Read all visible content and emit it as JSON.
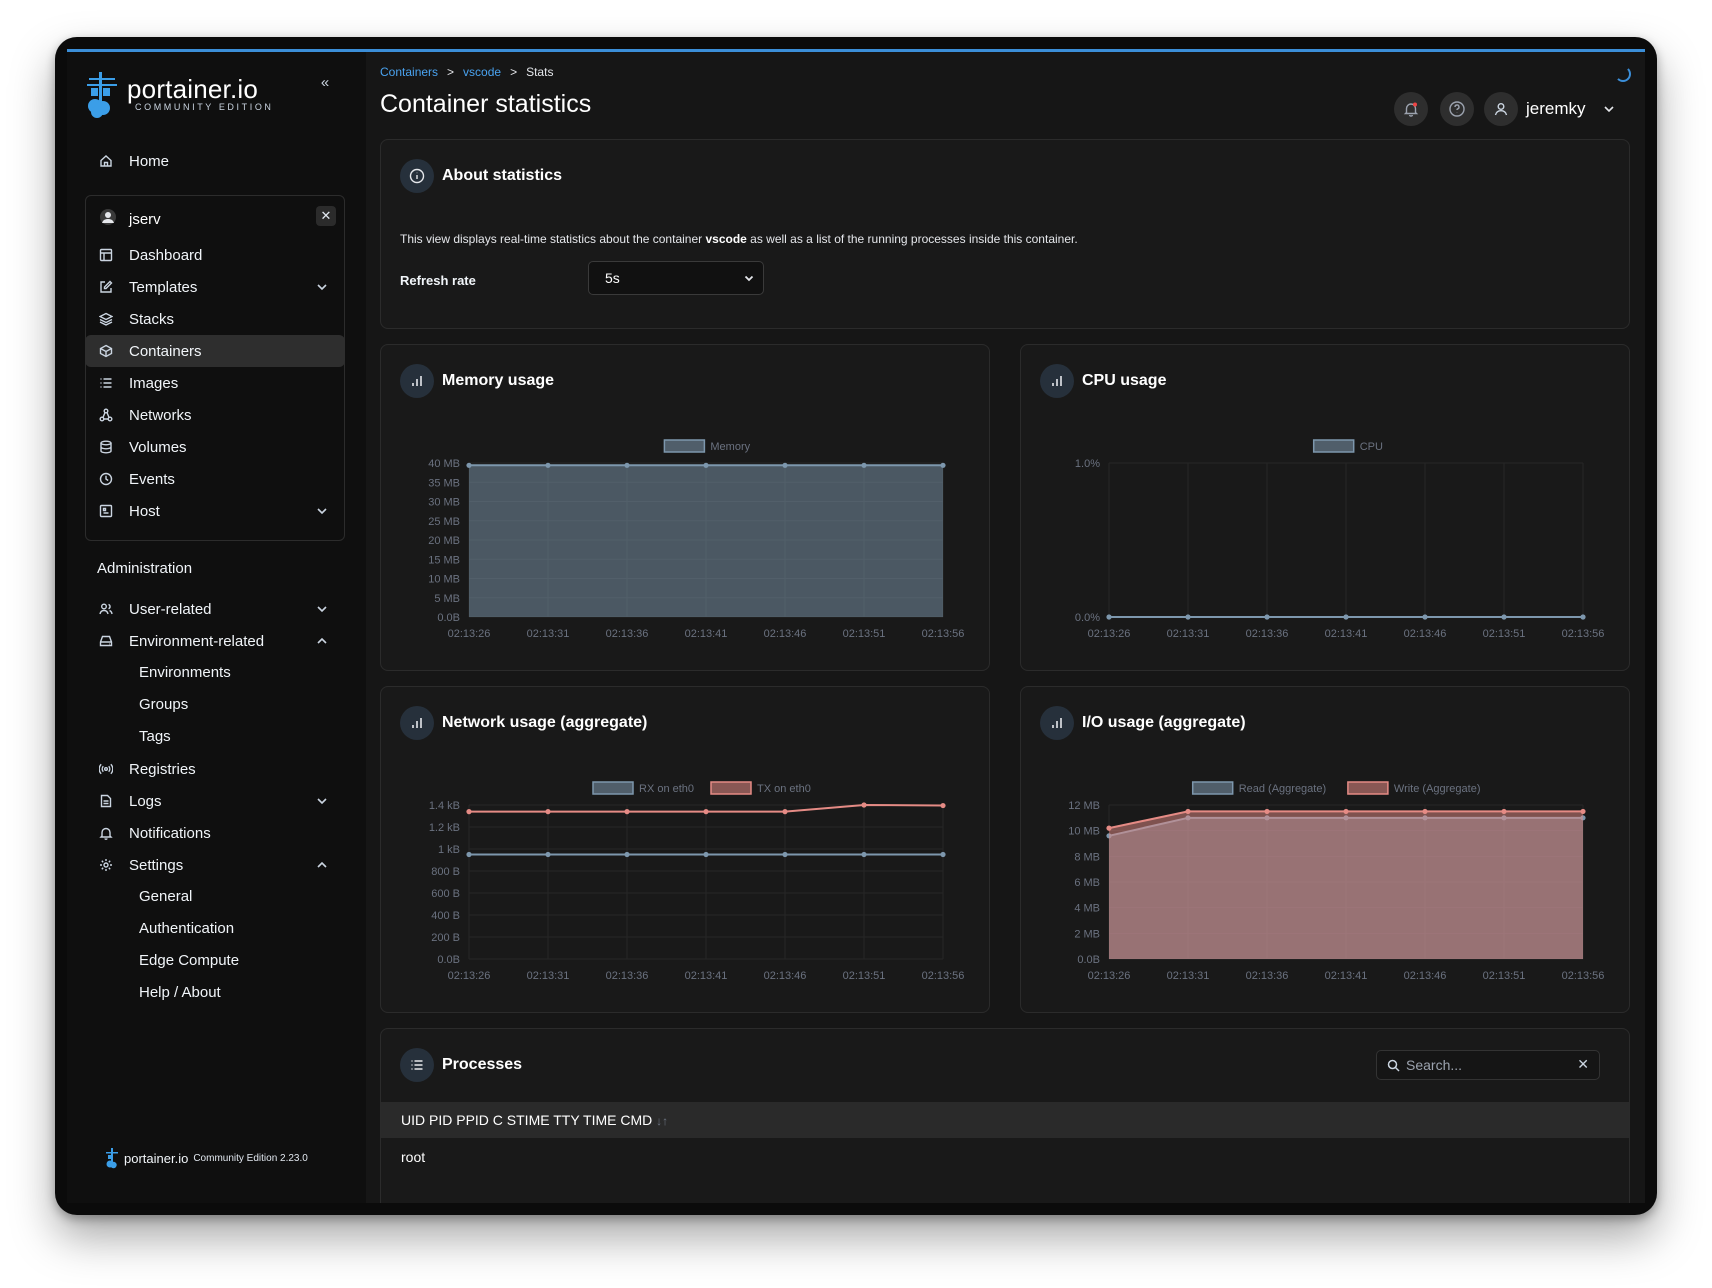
{
  "sidebar": {
    "logo_main": "portainer.io",
    "logo_sub": "COMMUNITY EDITION",
    "home": "Home",
    "environment": {
      "name": "jserv",
      "items": [
        "Dashboard",
        "Templates",
        "Stacks",
        "Containers",
        "Images",
        "Networks",
        "Volumes",
        "Events",
        "Host"
      ]
    },
    "admin_title": "Administration",
    "admin": {
      "user_related": "User-related",
      "environment_related": "Environment-related",
      "environments": "Environments",
      "groups": "Groups",
      "tags": "Tags",
      "registries": "Registries",
      "logs": "Logs",
      "notifications": "Notifications",
      "settings": "Settings",
      "general": "General",
      "authentication": "Authentication",
      "edge_compute": "Edge Compute",
      "help_about": "Help / About"
    },
    "footer": {
      "brand": "portainer.io",
      "edition": "Community Edition 2.23.0"
    }
  },
  "breadcrumb": {
    "c1": "Containers",
    "c2": "vscode",
    "c3": "Stats",
    "sep": ">"
  },
  "page_title": "Container statistics",
  "user": {
    "name": "jeremky"
  },
  "about": {
    "title": "About statistics",
    "text_before": "This view displays real-time statistics about the container ",
    "container": "vscode",
    "text_after": " as well as a list of the running processes inside this container.",
    "refresh_label": "Refresh rate",
    "refresh_value": "5s"
  },
  "colors": {
    "accent": "#3b8ed8",
    "series_blue": "#7d97ad",
    "series_red": "#e58b85"
  },
  "panels": {
    "memory_title": "Memory usage",
    "cpu_title": "CPU usage",
    "network_title": "Network usage (aggregate)",
    "io_title": "I/O usage (aggregate)"
  },
  "chart_data": [
    {
      "type": "area",
      "title": "Memory usage",
      "x": [
        "02:13:26",
        "02:13:31",
        "02:13:36",
        "02:13:41",
        "02:13:46",
        "02:13:51",
        "02:13:56"
      ],
      "yticks": [
        "0.0B",
        "5 MB",
        "10 MB",
        "15 MB",
        "20 MB",
        "25 MB",
        "30 MB",
        "35 MB",
        "40 MB"
      ],
      "ylim": [
        0,
        40
      ],
      "series": [
        {
          "name": "Memory",
          "values": [
            39.4,
            39.4,
            39.4,
            39.4,
            39.4,
            39.4,
            39.4
          ],
          "color": "#7d97ad"
        }
      ],
      "legend": "top-center",
      "grid": true
    },
    {
      "type": "line",
      "title": "CPU usage",
      "x": [
        "02:13:26",
        "02:13:31",
        "02:13:36",
        "02:13:41",
        "02:13:46",
        "02:13:51",
        "02:13:56"
      ],
      "yticks": [
        "0.0%",
        "1.0%"
      ],
      "ylim": [
        0,
        1
      ],
      "series": [
        {
          "name": "CPU",
          "values": [
            0,
            0,
            0,
            0,
            0,
            0,
            0
          ],
          "color": "#7d97ad"
        }
      ],
      "legend": "top-center",
      "grid": true
    },
    {
      "type": "line",
      "title": "Network usage (aggregate)",
      "x": [
        "02:13:26",
        "02:13:31",
        "02:13:36",
        "02:13:41",
        "02:13:46",
        "02:13:51",
        "02:13:56"
      ],
      "yticks": [
        "0.0B",
        "200 B",
        "400 B",
        "600 B",
        "800 B",
        "1 kB",
        "1.2 kB",
        "1.4 kB"
      ],
      "ylim": [
        0,
        1400
      ],
      "series": [
        {
          "name": "RX on eth0",
          "values": [
            950,
            950,
            950,
            950,
            950,
            950,
            950
          ],
          "color": "#7d97ad"
        },
        {
          "name": "TX on eth0",
          "values": [
            1340,
            1340,
            1340,
            1340,
            1340,
            1400,
            1395
          ],
          "color": "#e58b85"
        }
      ],
      "legend": "top-center",
      "grid": true
    },
    {
      "type": "area",
      "title": "I/O usage (aggregate)",
      "x": [
        "02:13:26",
        "02:13:31",
        "02:13:36",
        "02:13:41",
        "02:13:46",
        "02:13:51",
        "02:13:56"
      ],
      "yticks": [
        "0.0B",
        "2 MB",
        "4 MB",
        "6 MB",
        "8 MB",
        "10 MB",
        "12 MB"
      ],
      "ylim": [
        0,
        12
      ],
      "series": [
        {
          "name": "Read (Aggregate)",
          "values": [
            9.6,
            11.0,
            11.0,
            11.0,
            11.0,
            11.0,
            11.0
          ],
          "color": "#7d97ad"
        },
        {
          "name": "Write (Aggregate)",
          "values": [
            10.2,
            11.5,
            11.5,
            11.5,
            11.5,
            11.5,
            11.5
          ],
          "color": "#e58b85"
        }
      ],
      "legend": "top-center",
      "grid": true
    }
  ],
  "processes": {
    "title": "Processes",
    "search_placeholder": "Search...",
    "header": "UID PID PPID C STIME TTY TIME CMD",
    "sort_glyph": "↓↑",
    "rows": [
      "root"
    ]
  }
}
